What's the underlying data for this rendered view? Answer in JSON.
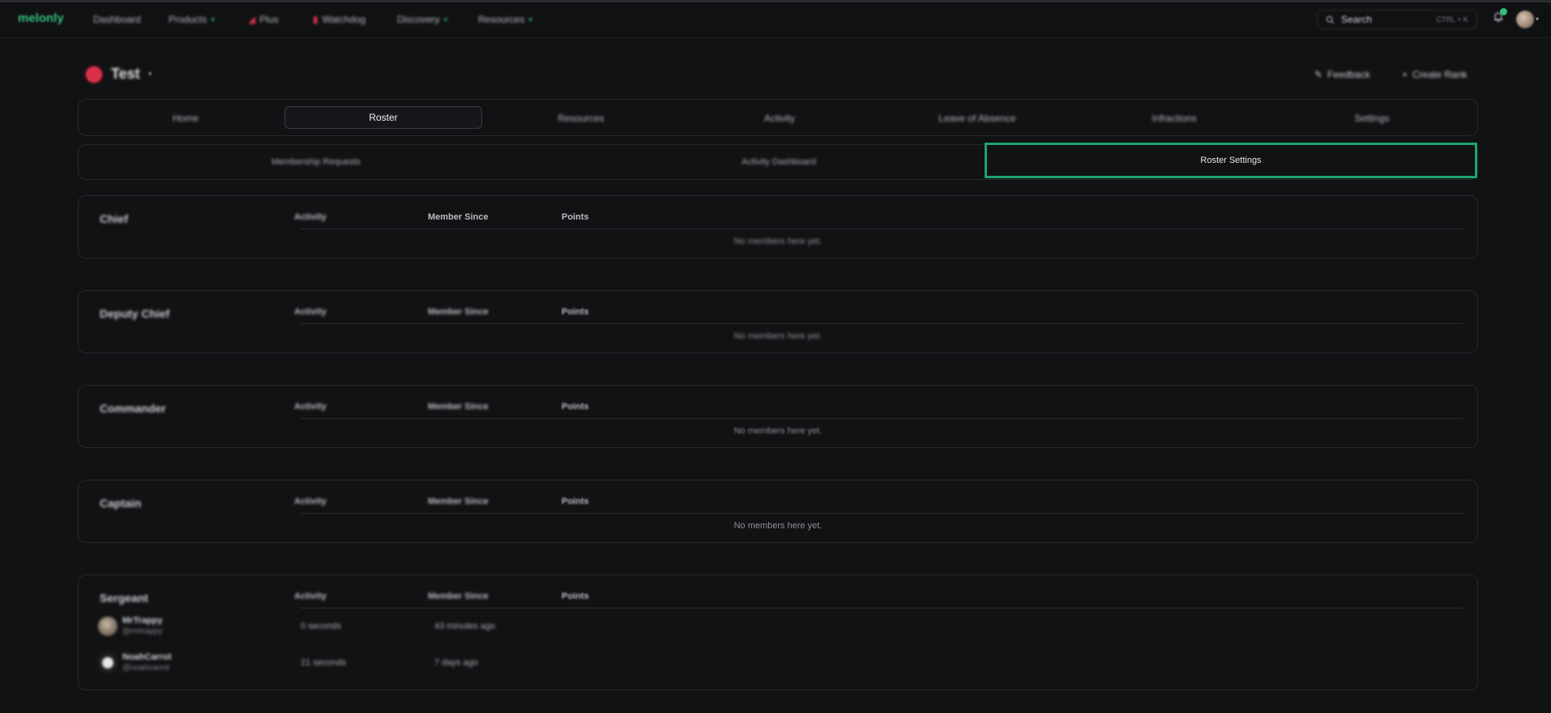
{
  "topbar": {
    "brand": "melonly",
    "nav": [
      {
        "label": "Dashboard",
        "has_chevron": false
      },
      {
        "label": "Products",
        "has_chevron": true
      },
      {
        "label": "Plus",
        "has_chevron": false
      },
      {
        "label": "Watchdog",
        "has_chevron": false
      },
      {
        "label": "Discovery",
        "has_chevron": true
      },
      {
        "label": "Resources",
        "has_chevron": true
      }
    ],
    "search_label": "Search",
    "search_shortcut": "CTRL + K",
    "accent_color": "#2fbf79"
  },
  "group": {
    "name": "Test",
    "feedback_label": "Feedback",
    "create_rank_label": "Create Rank",
    "badge_color": "#d9304a"
  },
  "tabs": [
    "Home",
    "Roster",
    "Resources",
    "Activity",
    "Leave of Absence",
    "Infractions",
    "Settings"
  ],
  "active_tab": "Roster",
  "subtabs": [
    "Membership Requests",
    "Activity Dashboard",
    "Roster Settings"
  ],
  "active_subtab": "Roster Settings",
  "highlight_color": "#1ea36a",
  "columns": {
    "activity": "Activity",
    "member_since": "Member Since",
    "points": "Points"
  },
  "empty_text": "No members here yet.",
  "ranks": [
    {
      "name": "Chief"
    },
    {
      "name": "Deputy Chief"
    },
    {
      "name": "Commander"
    },
    {
      "name": "Captain"
    },
    {
      "name": "Sergeant"
    }
  ],
  "sergeant_members": [
    {
      "name": "MrTrappy",
      "handle": "@mrtrappy",
      "activity": "0 seconds",
      "member_since": "43 minutes ago"
    },
    {
      "name": "NoahCarrot",
      "handle": "@noahcarrot",
      "activity": "21 seconds",
      "member_since": "7 days ago"
    }
  ]
}
